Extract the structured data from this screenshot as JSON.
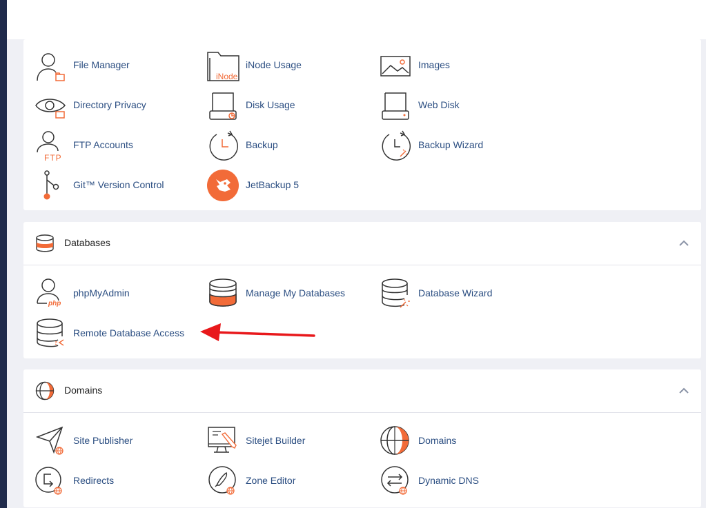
{
  "files": {
    "items": [
      {
        "label": "File Manager"
      },
      {
        "label": "iNode Usage",
        "icon_text": "iNode"
      },
      {
        "label": "Images"
      },
      {
        "label": "Directory Privacy"
      },
      {
        "label": "Disk Usage"
      },
      {
        "label": "Web Disk"
      },
      {
        "label": "FTP Accounts",
        "icon_text": "FTP"
      },
      {
        "label": "Backup"
      },
      {
        "label": "Backup Wizard"
      },
      {
        "label": "Git™ Version Control"
      },
      {
        "label": "JetBackup 5"
      }
    ]
  },
  "databases": {
    "title": "Databases",
    "items": [
      {
        "label": "phpMyAdmin",
        "icon_text": "php"
      },
      {
        "label": "Manage My Databases"
      },
      {
        "label": "Database Wizard"
      },
      {
        "label": "Remote Database Access"
      }
    ]
  },
  "domains": {
    "title": "Domains",
    "items": [
      {
        "label": "Site Publisher"
      },
      {
        "label": "Sitejet Builder"
      },
      {
        "label": "Domains"
      },
      {
        "label": "Redirects"
      },
      {
        "label": "Zone Editor"
      },
      {
        "label": "Dynamic DNS"
      }
    ]
  },
  "colors": {
    "accent": "#f26b38",
    "link": "#2a4d81",
    "sidebar": "#1f2a4b",
    "annotation_arrow": "#e8181b"
  }
}
